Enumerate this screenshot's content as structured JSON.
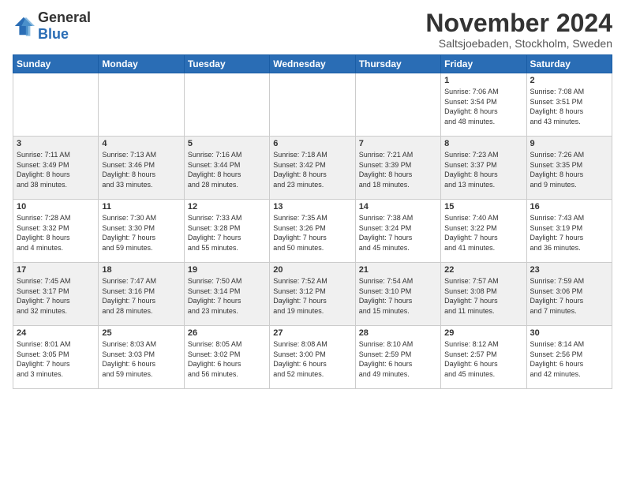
{
  "logo": {
    "general": "General",
    "blue": "Blue"
  },
  "header": {
    "month": "November 2024",
    "location": "Saltsjoebaden, Stockholm, Sweden"
  },
  "weekdays": [
    "Sunday",
    "Monday",
    "Tuesday",
    "Wednesday",
    "Thursday",
    "Friday",
    "Saturday"
  ],
  "weeks": [
    [
      {
        "day": "",
        "info": ""
      },
      {
        "day": "",
        "info": ""
      },
      {
        "day": "",
        "info": ""
      },
      {
        "day": "",
        "info": ""
      },
      {
        "day": "",
        "info": ""
      },
      {
        "day": "1",
        "info": "Sunrise: 7:06 AM\nSunset: 3:54 PM\nDaylight: 8 hours\nand 48 minutes."
      },
      {
        "day": "2",
        "info": "Sunrise: 7:08 AM\nSunset: 3:51 PM\nDaylight: 8 hours\nand 43 minutes."
      }
    ],
    [
      {
        "day": "3",
        "info": "Sunrise: 7:11 AM\nSunset: 3:49 PM\nDaylight: 8 hours\nand 38 minutes."
      },
      {
        "day": "4",
        "info": "Sunrise: 7:13 AM\nSunset: 3:46 PM\nDaylight: 8 hours\nand 33 minutes."
      },
      {
        "day": "5",
        "info": "Sunrise: 7:16 AM\nSunset: 3:44 PM\nDaylight: 8 hours\nand 28 minutes."
      },
      {
        "day": "6",
        "info": "Sunrise: 7:18 AM\nSunset: 3:42 PM\nDaylight: 8 hours\nand 23 minutes."
      },
      {
        "day": "7",
        "info": "Sunrise: 7:21 AM\nSunset: 3:39 PM\nDaylight: 8 hours\nand 18 minutes."
      },
      {
        "day": "8",
        "info": "Sunrise: 7:23 AM\nSunset: 3:37 PM\nDaylight: 8 hours\nand 13 minutes."
      },
      {
        "day": "9",
        "info": "Sunrise: 7:26 AM\nSunset: 3:35 PM\nDaylight: 8 hours\nand 9 minutes."
      }
    ],
    [
      {
        "day": "10",
        "info": "Sunrise: 7:28 AM\nSunset: 3:32 PM\nDaylight: 8 hours\nand 4 minutes."
      },
      {
        "day": "11",
        "info": "Sunrise: 7:30 AM\nSunset: 3:30 PM\nDaylight: 7 hours\nand 59 minutes."
      },
      {
        "day": "12",
        "info": "Sunrise: 7:33 AM\nSunset: 3:28 PM\nDaylight: 7 hours\nand 55 minutes."
      },
      {
        "day": "13",
        "info": "Sunrise: 7:35 AM\nSunset: 3:26 PM\nDaylight: 7 hours\nand 50 minutes."
      },
      {
        "day": "14",
        "info": "Sunrise: 7:38 AM\nSunset: 3:24 PM\nDaylight: 7 hours\nand 45 minutes."
      },
      {
        "day": "15",
        "info": "Sunrise: 7:40 AM\nSunset: 3:22 PM\nDaylight: 7 hours\nand 41 minutes."
      },
      {
        "day": "16",
        "info": "Sunrise: 7:43 AM\nSunset: 3:19 PM\nDaylight: 7 hours\nand 36 minutes."
      }
    ],
    [
      {
        "day": "17",
        "info": "Sunrise: 7:45 AM\nSunset: 3:17 PM\nDaylight: 7 hours\nand 32 minutes."
      },
      {
        "day": "18",
        "info": "Sunrise: 7:47 AM\nSunset: 3:16 PM\nDaylight: 7 hours\nand 28 minutes."
      },
      {
        "day": "19",
        "info": "Sunrise: 7:50 AM\nSunset: 3:14 PM\nDaylight: 7 hours\nand 23 minutes."
      },
      {
        "day": "20",
        "info": "Sunrise: 7:52 AM\nSunset: 3:12 PM\nDaylight: 7 hours\nand 19 minutes."
      },
      {
        "day": "21",
        "info": "Sunrise: 7:54 AM\nSunset: 3:10 PM\nDaylight: 7 hours\nand 15 minutes."
      },
      {
        "day": "22",
        "info": "Sunrise: 7:57 AM\nSunset: 3:08 PM\nDaylight: 7 hours\nand 11 minutes."
      },
      {
        "day": "23",
        "info": "Sunrise: 7:59 AM\nSunset: 3:06 PM\nDaylight: 7 hours\nand 7 minutes."
      }
    ],
    [
      {
        "day": "24",
        "info": "Sunrise: 8:01 AM\nSunset: 3:05 PM\nDaylight: 7 hours\nand 3 minutes."
      },
      {
        "day": "25",
        "info": "Sunrise: 8:03 AM\nSunset: 3:03 PM\nDaylight: 6 hours\nand 59 minutes."
      },
      {
        "day": "26",
        "info": "Sunrise: 8:05 AM\nSunset: 3:02 PM\nDaylight: 6 hours\nand 56 minutes."
      },
      {
        "day": "27",
        "info": "Sunrise: 8:08 AM\nSunset: 3:00 PM\nDaylight: 6 hours\nand 52 minutes."
      },
      {
        "day": "28",
        "info": "Sunrise: 8:10 AM\nSunset: 2:59 PM\nDaylight: 6 hours\nand 49 minutes."
      },
      {
        "day": "29",
        "info": "Sunrise: 8:12 AM\nSunset: 2:57 PM\nDaylight: 6 hours\nand 45 minutes."
      },
      {
        "day": "30",
        "info": "Sunrise: 8:14 AM\nSunset: 2:56 PM\nDaylight: 6 hours\nand 42 minutes."
      }
    ]
  ]
}
